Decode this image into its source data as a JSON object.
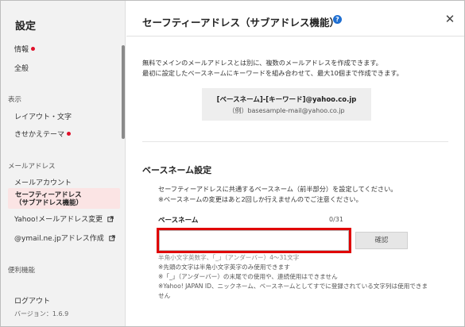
{
  "sidebar": {
    "title": "設定",
    "items_top": [
      {
        "label": "情報",
        "dot": true
      },
      {
        "label": "全般",
        "dot": false
      }
    ],
    "section_display": "表示",
    "items_display": [
      {
        "label": "レイアウト・文字",
        "dot": false
      },
      {
        "label": "きせかえテーマ",
        "dot": true
      }
    ],
    "section_mail": "メールアドレス",
    "items_mail": [
      {
        "label": "メールアカウント"
      },
      {
        "label": "セーフティーアドレス\n（サブアドレス機能）",
        "active": true
      },
      {
        "label": "Yahoo!メールアドレス変更",
        "external": true
      },
      {
        "label": "@ymail.ne.jpアドレス作成",
        "external": true
      }
    ],
    "section_util": "便利機能",
    "logout": "ログアウト",
    "version": "バージョン：1.6.9",
    "dot_color": "#e0102a",
    "active_bg": "#fbe4e4"
  },
  "main": {
    "title": "セーフティーアドレス（サブアドレス機能）",
    "help_label": "?",
    "close_label": "✕",
    "description_line1": "無料でメインのメールアドレスとは別に、複数のメールアドレスを作成できます。",
    "description_line2": "最初に設定したベースネームにキーワードを組み合わせて、最大10個まで作成できます。",
    "example_format": "[ベースネーム]-[キーワード]@yahoo.co.jp",
    "example_sample": "（例）basesample-mail@yahoo.co.jp",
    "section_title": "ベースネーム設定",
    "section_desc1": "セーフティーアドレスに共通するベースネーム（前半部分）を設定してください。",
    "section_desc2": "※ベースネームの変更はあと2回しか行えませんのでご注意ください。",
    "field_label": "ベースネーム",
    "counter": "0/31",
    "input_value": "",
    "input_placeholder": "",
    "confirm_label": "確認",
    "notes": [
      "半角小文字英数字、「_」（アンダーバー）4～31文字",
      "※先頭の文字は半角小文字英字のみ使用できます",
      "※「_」（アンダーバー）の末尾での使用や、連続使用はできません",
      "※Yahoo! JAPAN ID、ニックネーム、ベースネームとしてすでに登録されている文字列は使用できま",
      "せん"
    ],
    "help_color": "#1f6fd1",
    "highlight_color": "#e00000"
  }
}
